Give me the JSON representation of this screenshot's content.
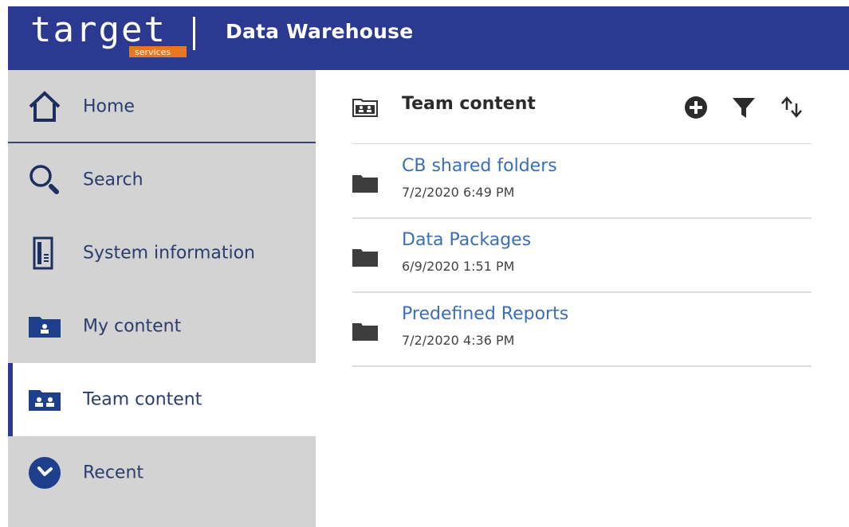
{
  "header": {
    "logo_text": "target",
    "logo_sub": "services",
    "title": "Data Warehouse"
  },
  "sidebar": {
    "items": [
      {
        "label": "Home",
        "icon": "home-icon",
        "active": false
      },
      {
        "label": "Search",
        "icon": "search-icon",
        "active": false
      },
      {
        "label": "System information",
        "icon": "system-information-icon",
        "active": false
      },
      {
        "label": "My content",
        "icon": "my-content-icon",
        "active": false
      },
      {
        "label": "Team content",
        "icon": "team-content-icon",
        "active": true
      },
      {
        "label": "Recent",
        "icon": "recent-icon",
        "active": false
      }
    ]
  },
  "main": {
    "title": "Team content",
    "title_icon": "team-folder-icon",
    "toolbar": {
      "add_icon": "add-circle-icon",
      "filter_icon": "filter-icon",
      "sort_icon": "sort-icon"
    },
    "rows": [
      {
        "name": "CB shared folders",
        "date": "7/2/2020 6:49 PM"
      },
      {
        "name": "Data Packages",
        "date": "6/9/2020 1:51 PM"
      },
      {
        "name": "Predefined Reports",
        "date": "7/2/2020 4:36 PM"
      }
    ]
  },
  "colors": {
    "header_bg": "#2b3990",
    "sidebar_bg": "#d3d3d3",
    "link": "#3a6fb5",
    "logo_accent": "#e87722"
  }
}
